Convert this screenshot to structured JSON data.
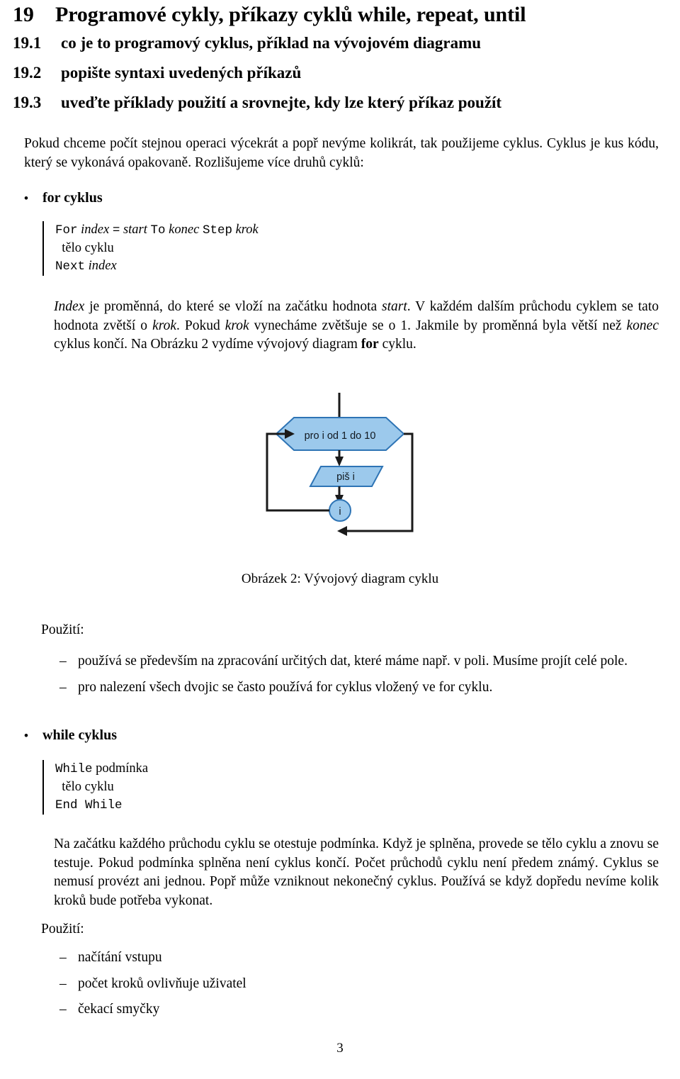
{
  "document": {
    "page_number": "3",
    "figure_caption": "Obrázek 2: Vývojový diagram cyklu"
  },
  "headings": {
    "chapter": {
      "number": "19",
      "title": "Programové cykly, příkazy cyklů while, repeat, until"
    },
    "sections": [
      {
        "number": "19.1",
        "title": "co je to programový cyklus, příklad na vývojovém diagramu"
      },
      {
        "number": "19.2",
        "title": "popište syntaxi uvedených příkazů"
      },
      {
        "number": "19.3",
        "title": "uveďte příklady použití a srovnejte, kdy lze který příkaz použít"
      }
    ]
  },
  "intro": {
    "text": "Pokud chceme počít stejnou operaci výcekrát a popř nevýme kolikrát, tak použijeme cyklus. Cyklus je kus kódu, který se vykonává opakovaně. Rozlišujeme více druhů cyklů:"
  },
  "for_section": {
    "bullet_marker": "•",
    "bullet_label": "for cyklus",
    "code": {
      "line1_kw1": "For",
      "line1_var1": "index",
      "line1_op": "=",
      "line1_var2": "start",
      "line1_kw2": "To",
      "line1_var3": "konec",
      "line1_kw3": "Step",
      "line1_var4": "krok",
      "line2": "tělo cyklu",
      "line3_kw": "Next",
      "line3_var": "index"
    },
    "description_html": "<span class=\"it\">Index</span> je proměnná, do které se vloží na začátku hodnota <span class=\"it\">start</span>. V každém dalším průchodu cyklem se tato hodnota zvětší o <span class=\"it\">krok</span>. Pokud <span class=\"it\">krok</span> vynecháme zvětšuje se o 1. Jakmile by proměnná byla větší než <span class=\"it\">konec</span> cyklus končí. Na Obrázku 2 vydíme vývojový diagram <span class=\"bold\">for</span> cyklu.",
    "usage_label": "Použití:",
    "usage_items": [
      {
        "marker": "–",
        "text": "používá se především na zpracování určitých dat, které máme např. v poli. Musíme projít celé pole."
      },
      {
        "marker": "–",
        "text": "pro nalezení všech dvojic se často používá for cyklus vložený ve for cyklu."
      }
    ]
  },
  "while_section": {
    "bullet_marker": "•",
    "bullet_label": "while cyklus",
    "code": {
      "line1_kw": "While",
      "line1_txt": "podmínka",
      "line2": "tělo cyklu",
      "line3_kw": "End While"
    },
    "description_html": "Na začátku každého průchodu cyklu se otestuje podmínka. Když je splněna, provede se tělo cyklu a znovu se testuje. Pokud podmínka splněna není cyklus končí. Počet průchodů cyklu není předem známý. Cyklus se nemusí provézt ani jednou. Popř může vzniknout nekonečný cyklus. Používá se když dopředu nevíme kolik kroků bude potřeba vykonat.",
    "usage_label": "Použití:",
    "usage_items": [
      {
        "marker": "–",
        "text": "načítání vstupu"
      },
      {
        "marker": "–",
        "text": "počet kroků ovlivňuje uživatel"
      },
      {
        "marker": "–",
        "text": "čekací smyčky"
      }
    ]
  },
  "flowchart": {
    "nodes": [
      {
        "id": "loop-header",
        "shape": "hexagon",
        "label": "pro i od 1 do 10"
      },
      {
        "id": "output",
        "shape": "parallelogram",
        "label": "piš i"
      },
      {
        "id": "increment",
        "shape": "circle",
        "label": "i"
      }
    ],
    "colors": {
      "fill": "#9CC9EC",
      "stroke": "#2E74B5",
      "connector": "#1A1A1A"
    }
  }
}
